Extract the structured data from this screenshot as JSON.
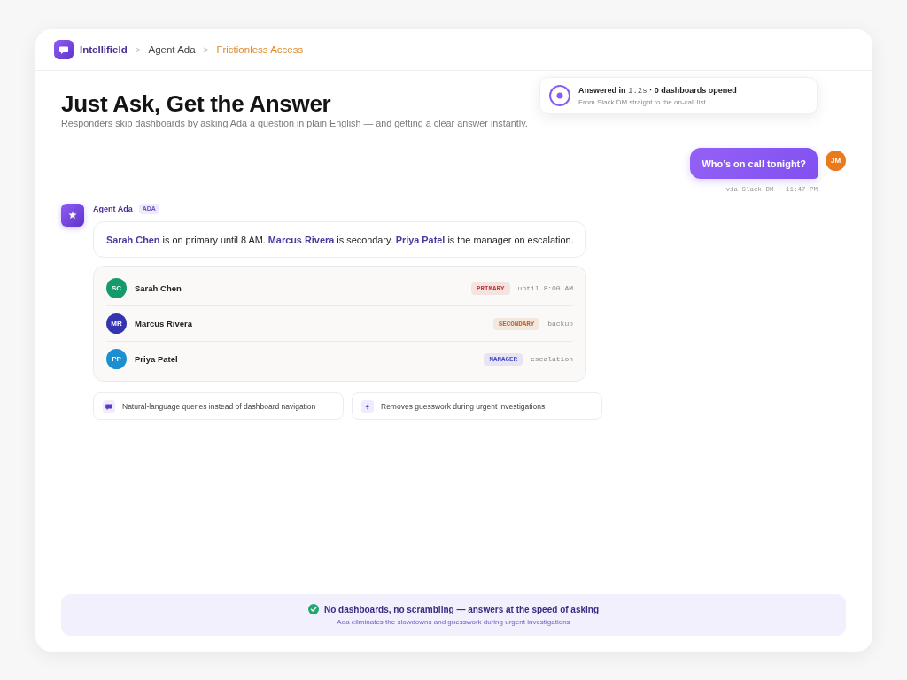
{
  "header": {
    "breadcrumbs": [
      {
        "kind": "brand",
        "label": "Intellifield"
      },
      {
        "kind": "link",
        "label": "Agent Ada",
        "separator": ">"
      },
      {
        "kind": "current",
        "label": "Frictionless Access",
        "separator": ">"
      }
    ]
  },
  "hero": {
    "title": "Just Ask, Get the Answer",
    "subtitle": "Responders skip dashboards by asking Ada a question in plain English — and getting a clear answer instantly."
  },
  "status_toast": {
    "headline": {
      "before": "Answered in",
      "value": "1.2s",
      "after": "· 0 dashboards opened"
    },
    "detail": "From Slack DM straight to the on-call list"
  },
  "user_message": {
    "text": "Who’s on call tonight?",
    "avatar": "JM",
    "meta": "via Slack DM · 11:47 PM"
  },
  "agent_reply": {
    "name": "Agent Ada",
    "badge": "ADA",
    "answer": "**Sarah Chen** is on primary until 8 AM. **Marcus Rivera** is secondary. **Priya Patel** is the manager on escalation.",
    "roster": [
      {
        "avatar": {
          "initials": "SC",
          "color": "#159a69"
        },
        "name": "Sarah Chen",
        "role": {
          "label": "PRIMARY",
          "color": "#c23a3a"
        },
        "note": "until 8:00 AM"
      },
      {
        "avatar": {
          "initials": "MR",
          "color": "#3434b0"
        },
        "name": "Marcus Rivera",
        "role": {
          "label": "SECONDARY",
          "color": "#c0652a"
        },
        "note": "backup"
      },
      {
        "avatar": {
          "initials": "PP",
          "color": "#1b8fd0"
        },
        "name": "Priya Patel",
        "role": {
          "label": "MANAGER",
          "color": "#4848c8"
        },
        "note": "escalation"
      }
    ],
    "highlights": [
      {
        "kind": "language",
        "text": "Natural-language queries instead of dashboard navigation"
      },
      {
        "kind": "speed",
        "text": "Removes guesswork during urgent investigations"
      }
    ]
  },
  "footer_banner": {
    "title": "No dashboards, no scrambling — answers at the speed of asking",
    "subtitle": "Ada eliminates the slowdowns and guesswork during urgent investigations"
  }
}
